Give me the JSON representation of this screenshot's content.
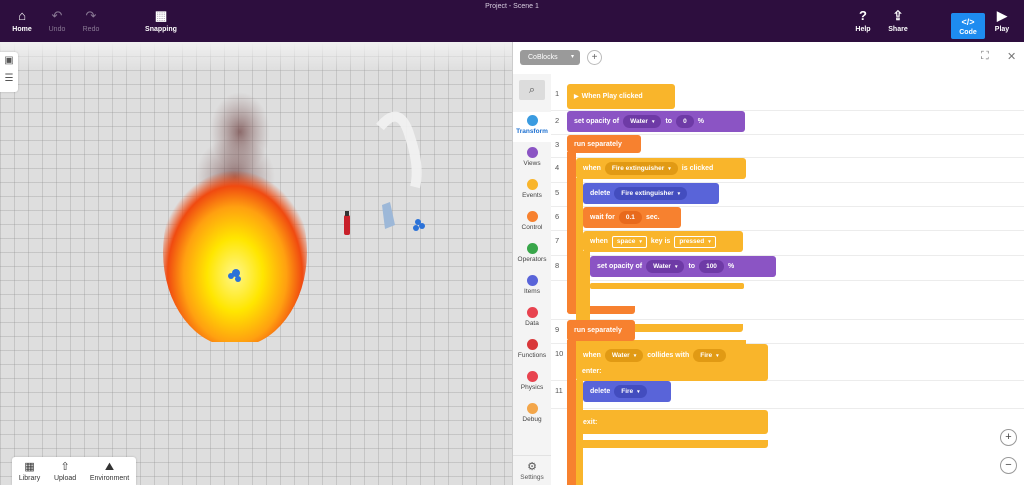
{
  "topbar": {
    "title": "Project - Scene 1",
    "home_label": "Home",
    "undo_label": "Undo",
    "redo_label": "Redo",
    "snapping_label": "Snapping",
    "help_label": "Help",
    "share_label": "Share",
    "code_label": "Code",
    "play_label": "Play"
  },
  "scene": {
    "library_label": "Library",
    "upload_label": "Upload",
    "environment_label": "Environment"
  },
  "panel": {
    "dropdown_label": "CoBlocks",
    "add_tab_label": "+"
  },
  "categories": [
    {
      "label": "Transform",
      "color": "#3a9be0"
    },
    {
      "label": "Views",
      "color": "#8b54c4"
    },
    {
      "label": "Events",
      "color": "#f9b52b"
    },
    {
      "label": "Control",
      "color": "#f7812f"
    },
    {
      "label": "Operators",
      "color": "#38a64a"
    },
    {
      "label": "Items",
      "color": "#5964d9"
    },
    {
      "label": "Data",
      "color": "#e8434f"
    },
    {
      "label": "Functions",
      "color": "#d9383a"
    },
    {
      "label": "Physics",
      "color": "#e8434f"
    },
    {
      "label": "Debug",
      "color": "#f3a64a"
    }
  ],
  "settings_label": "Settings",
  "line_numbers": [
    "1",
    "2",
    "3",
    "4",
    "5",
    "6",
    "7",
    "8",
    "9",
    "10",
    "11"
  ],
  "code": {
    "when_play": "When Play clicked",
    "set_opacity": "set opacity of",
    "water": "Water",
    "to": "to",
    "zero": "0",
    "percent": "%",
    "run_separately": "run separately",
    "when": "when",
    "fire_extinguisher": "Fire extinguisher",
    "is_clicked": "is clicked",
    "delete": "delete",
    "wait_for": "wait for",
    "wait_value": "0.1",
    "sec": "sec.",
    "space": "space",
    "key_is": "key is",
    "pressed": "pressed",
    "hundred": "100",
    "collides_with": "collides with",
    "fire": "Fire",
    "enter": "enter:",
    "exit": "exit:"
  }
}
